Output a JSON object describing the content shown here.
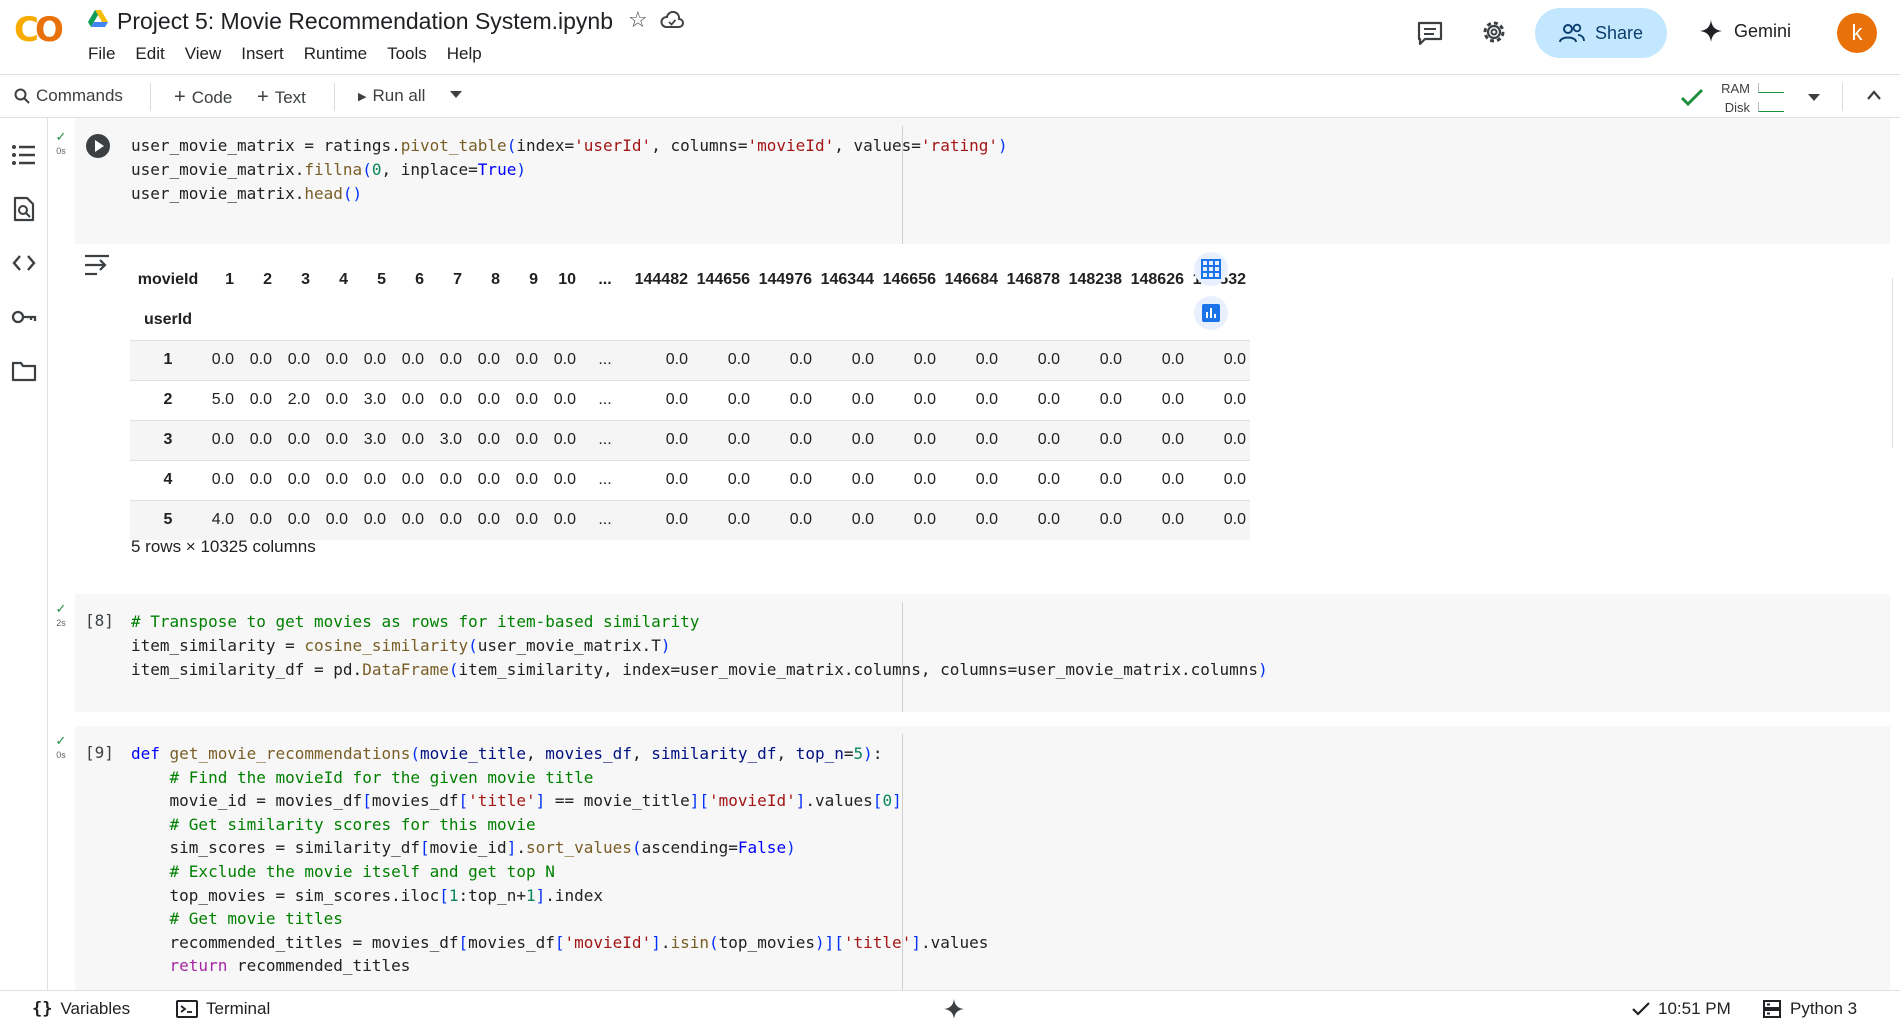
{
  "header": {
    "title": "Project 5: Movie Recommendation System.ipynb",
    "menu": [
      "File",
      "Edit",
      "View",
      "Insert",
      "Runtime",
      "Tools",
      "Help"
    ],
    "share_label": "Share",
    "gemini_label": "Gemini",
    "avatar_letter": "k",
    "colors": {
      "share_bg": "#c2e7ff",
      "avatar_bg": "#e8710a",
      "logo": "#f9ab00"
    }
  },
  "toolbar": {
    "commands_label": "Commands",
    "code_label": "Code",
    "text_label": "Text",
    "run_all_label": "Run all",
    "ram_label": "RAM",
    "disk_label": "Disk"
  },
  "cells": {
    "cell1": {
      "time": "0s",
      "code": [
        "user_movie_matrix = ratings.pivot_table(index='userId', columns='movieId', values='rating')",
        "user_movie_matrix.fillna(0, inplace=True)",
        "user_movie_matrix.head()"
      ]
    },
    "cell2": {
      "exec_count": "[8]",
      "time": "2s",
      "code": [
        "# Transpose to get movies as rows for item-based similarity",
        "item_similarity = cosine_similarity(user_movie_matrix.T)",
        "item_similarity_df = pd.DataFrame(item_similarity, index=user_movie_matrix.columns, columns=user_movie_matrix.columns)"
      ]
    },
    "cell3": {
      "exec_count": "[9]",
      "time": "0s",
      "code": [
        "def get_movie_recommendations(movie_title, movies_df, similarity_df, top_n=5):",
        "    # Find the movieId for the given movie title",
        "    movie_id = movies_df[movies_df['title'] == movie_title]['movieId'].values[0]",
        "    # Get similarity scores for this movie",
        "    sim_scores = similarity_df[movie_id].sort_values(ascending=False)",
        "    # Exclude the movie itself and get top N",
        "    top_movies = sim_scores.iloc[1:top_n+1].index",
        "    # Get movie titles",
        "    recommended_titles = movies_df[movies_df['movieId'].isin(top_movies)]['title'].values",
        "    return recommended_titles"
      ]
    }
  },
  "dataframe": {
    "columns_label": "movieId",
    "index_label": "userId",
    "columns": [
      "1",
      "2",
      "3",
      "4",
      "5",
      "6",
      "7",
      "8",
      "9",
      "10",
      "...",
      "144482",
      "144656",
      "144976",
      "146344",
      "146656",
      "146684",
      "146878",
      "148238",
      "148626",
      "149532"
    ],
    "rows": [
      {
        "index": "1",
        "values": [
          "0.0",
          "0.0",
          "0.0",
          "0.0",
          "0.0",
          "0.0",
          "0.0",
          "0.0",
          "0.0",
          "0.0",
          "...",
          "0.0",
          "0.0",
          "0.0",
          "0.0",
          "0.0",
          "0.0",
          "0.0",
          "0.0",
          "0.0",
          "0.0"
        ]
      },
      {
        "index": "2",
        "values": [
          "5.0",
          "0.0",
          "2.0",
          "0.0",
          "3.0",
          "0.0",
          "0.0",
          "0.0",
          "0.0",
          "0.0",
          "...",
          "0.0",
          "0.0",
          "0.0",
          "0.0",
          "0.0",
          "0.0",
          "0.0",
          "0.0",
          "0.0",
          "0.0"
        ]
      },
      {
        "index": "3",
        "values": [
          "0.0",
          "0.0",
          "0.0",
          "0.0",
          "3.0",
          "0.0",
          "3.0",
          "0.0",
          "0.0",
          "0.0",
          "...",
          "0.0",
          "0.0",
          "0.0",
          "0.0",
          "0.0",
          "0.0",
          "0.0",
          "0.0",
          "0.0",
          "0.0"
        ]
      },
      {
        "index": "4",
        "values": [
          "0.0",
          "0.0",
          "0.0",
          "0.0",
          "0.0",
          "0.0",
          "0.0",
          "0.0",
          "0.0",
          "0.0",
          "...",
          "0.0",
          "0.0",
          "0.0",
          "0.0",
          "0.0",
          "0.0",
          "0.0",
          "0.0",
          "0.0",
          "0.0"
        ]
      },
      {
        "index": "5",
        "values": [
          "4.0",
          "0.0",
          "0.0",
          "0.0",
          "0.0",
          "0.0",
          "0.0",
          "0.0",
          "0.0",
          "0.0",
          "...",
          "0.0",
          "0.0",
          "0.0",
          "0.0",
          "0.0",
          "0.0",
          "0.0",
          "0.0",
          "0.0",
          "0.0"
        ]
      }
    ],
    "caption": "5 rows × 10325 columns"
  },
  "statusbar": {
    "variables_label": "Variables",
    "terminal_label": "Terminal",
    "time": "10:51 PM",
    "runtime": "Python 3"
  }
}
